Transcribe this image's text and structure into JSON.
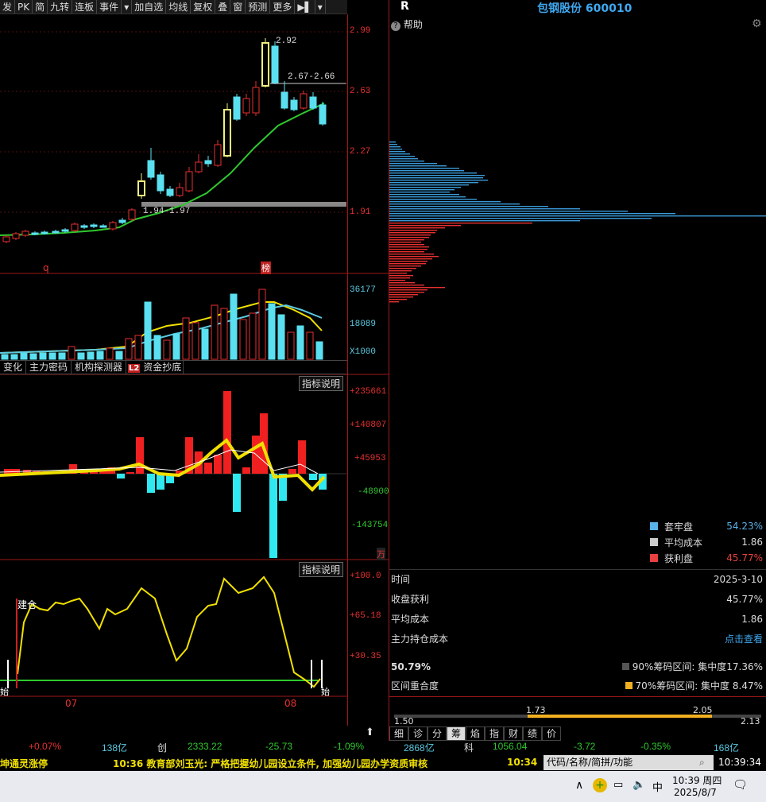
{
  "toolbar": [
    "发",
    "PK",
    "简",
    "九转",
    "连板",
    "事件",
    "▾",
    "加自选",
    "均线",
    "复权",
    "叠",
    "窗",
    "预测",
    "更多",
    "▶▌",
    "▾"
  ],
  "header": {
    "r_label": "R",
    "stock_name": "包钢股份 600010"
  },
  "help_label": "帮助",
  "price_axis": [
    "2.99",
    "2.63",
    "2.27",
    "1.91"
  ],
  "candle_labels": {
    "high": "2.92",
    "range": "2.67-2.66",
    "low": "1.94-1.97"
  },
  "marks": {
    "q": "q",
    "bang": "榜"
  },
  "volume_axis": [
    "36177",
    "18089",
    "X1000"
  ],
  "tabs": [
    "变化",
    "主力密码",
    "机构探测器",
    "L2",
    "资金抄底"
  ],
  "indicator_btn": "指标说明",
  "macd_axis": [
    "+235661",
    "+140807",
    "+45953",
    "-48900",
    "-143754"
  ],
  "macd_unit": "万",
  "ind2_axis": [
    "+100.0",
    "+65.18",
    "+30.35"
  ],
  "ind2_labels": {
    "jiancang": "建仓",
    "start1": "始",
    "start2": "始"
  },
  "date_labels": [
    "07",
    "08"
  ],
  "chips": {
    "legend": [
      {
        "label": "套牢盘",
        "value": "54.23%",
        "color": "#5ab0e8"
      },
      {
        "label": "平均成本",
        "value": "1.86",
        "color": "#cccccc"
      },
      {
        "label": "获利盘",
        "value": "45.77%",
        "color": "#e84040"
      }
    ],
    "time_label": "时间",
    "time_value": "2025-3-10",
    "profit_label": "收盘获利",
    "profit_value": "45.77%",
    "avg_label": "平均成本",
    "avg_value": "1.86",
    "main_label": "主力持仓成本",
    "main_value": "点击查看",
    "pct": "50.79%",
    "c90": "90%筹码区间: 集中度17.36%",
    "overlap": "区间重合度",
    "c70": "70%筹码区间: 集中度 8.47%",
    "bar_vals": [
      "1.50",
      "1.73",
      "2.05",
      "2.13"
    ]
  },
  "bottom_tabs": [
    "细",
    "诊",
    "分",
    "筹",
    "焰",
    "指",
    "财",
    "绩",
    "价"
  ],
  "status": {
    "s1": "+0.07%",
    "s2": "138亿",
    "s3": "创",
    "s4": "2333.22",
    "s5": "-25.73",
    "s6": "-1.09%",
    "s7": "2868亿",
    "s8": "科",
    "s9": "1056.04",
    "s10": "-3.72",
    "s11": "-0.35%",
    "s12": "168亿"
  },
  "ticker": {
    "left": "坤通灵涨停",
    "main": "10:36 教育部刘玉光: 严格把握幼儿园设立条件, 加强幼儿园办学资质审核",
    "right": "10:34",
    "time": "10:39:34"
  },
  "search_placeholder": "代码/名称/简拼/功能",
  "taskbar": {
    "ime": "中",
    "time": "10:39 周四",
    "date": "2025/8/7"
  }
}
